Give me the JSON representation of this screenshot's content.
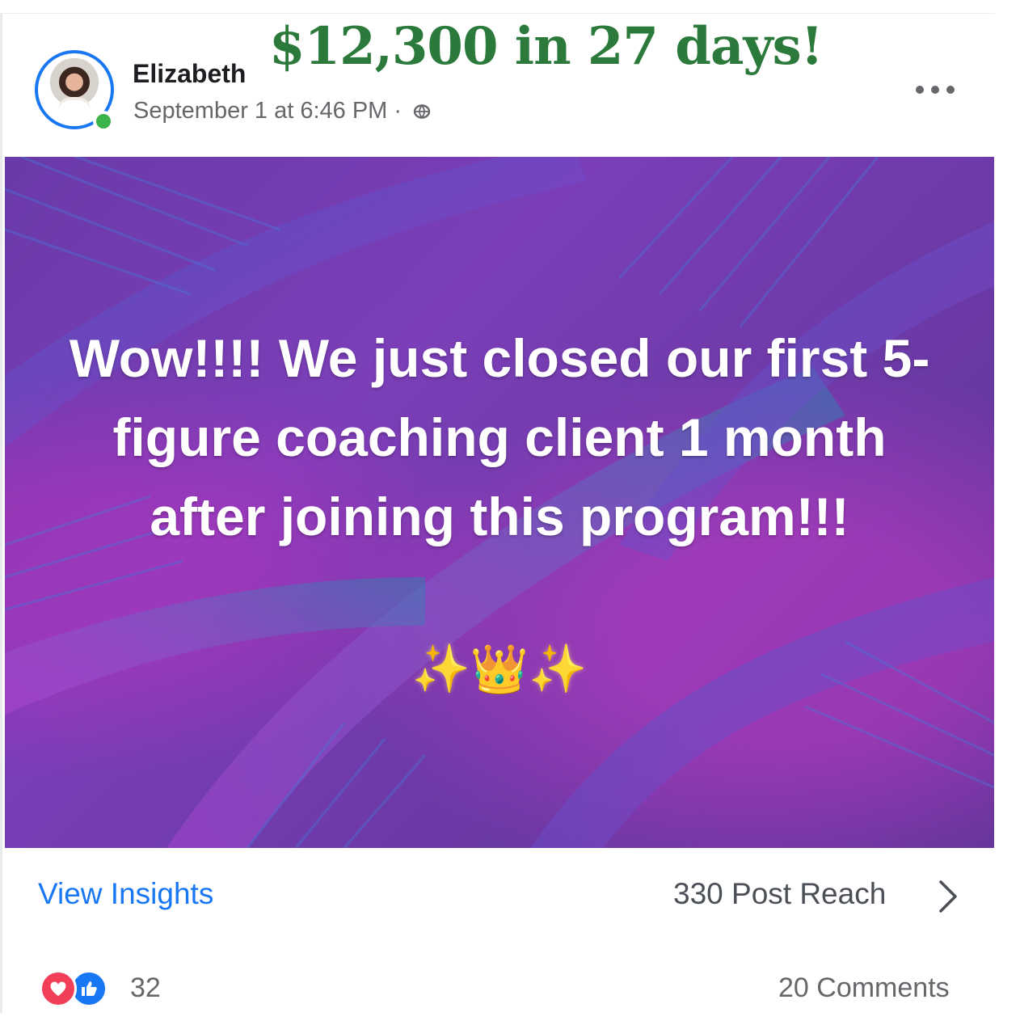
{
  "post": {
    "author_name": "Elizabeth",
    "timestamp": "September 1 at 6:46 PM ·",
    "image_text": "Wow!!!! We just closed our first 5-figure coaching client 1 month after joining this program!!!",
    "image_emojis": {
      "sparkles_left": "✨",
      "crown": "👑",
      "sparkles_right": "✨"
    }
  },
  "overlay": {
    "headline": "$12,300 in 27 days!",
    "color": "#2c7a3b"
  },
  "insights": {
    "view_insights_label": "View Insights",
    "post_reach": "330 Post Reach"
  },
  "engagement": {
    "reaction_count": "32",
    "comments": "20 Comments"
  },
  "icons": {
    "more": "more-horizontal-icon",
    "privacy": "globe-icon",
    "chevron": "chevron-right-icon",
    "reactions": [
      "heart-icon",
      "like-icon"
    ]
  },
  "colors": {
    "link_blue": "#1877f2",
    "image_purple": "#7b3eb8",
    "online_green": "#3ab34a"
  }
}
